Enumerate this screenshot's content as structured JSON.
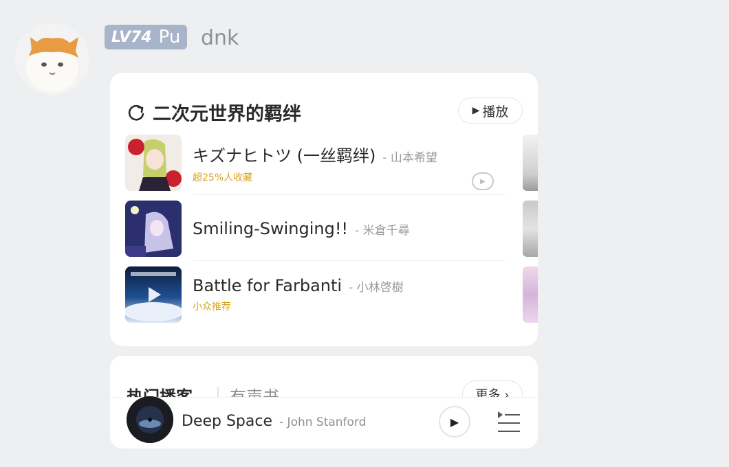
{
  "user": {
    "level": "LV74",
    "tag": "Pu",
    "name": "dnk"
  },
  "playlist_card": {
    "title": "二次元世界的羁绊",
    "play_label": "播放",
    "songs": [
      {
        "title": "キズナヒトツ (一丝羁绊)",
        "artist": "- 山本希望",
        "tag": "超25%人收藏"
      },
      {
        "title": "Smiling-Swinging!!",
        "artist": "- 米倉千尋",
        "tag": ""
      },
      {
        "title": "Battle for Farbanti",
        "artist": "- 小林啓樹",
        "tag": "小众推荐"
      }
    ]
  },
  "podcast_card": {
    "tab1": "热门播客",
    "tab2": "有声书",
    "more_label": "更多 ›"
  },
  "now_playing": {
    "title": "Deep Space",
    "artist": "- John Stanford"
  },
  "colors": {
    "background": "#eeeff1",
    "badge": "#a8b4c9",
    "tag_yellow": "#d9a21a"
  }
}
